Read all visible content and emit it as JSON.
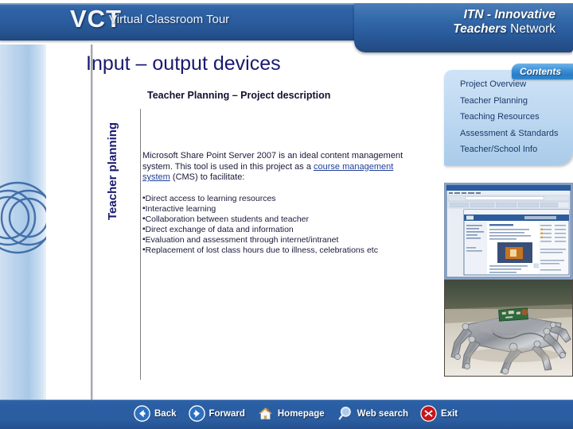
{
  "header": {
    "logo_abbr": "VCT",
    "logo_full": "Virtual Classroom Tour",
    "network_line1": "ITN - Innovative",
    "network_line2_bold": "Teachers",
    "network_line2_rest": " Network"
  },
  "slide": {
    "title": "Input – output devices",
    "subtitle": "Teacher Planning – Project description",
    "side_label": "Teacher planning",
    "paragraph": {
      "part1": "Microsoft Share Point Server 2007 is an ideal content management system. This tool is used in this project as a ",
      "link": "course management system",
      "part2": " (CMS) to facilitate:"
    },
    "bullets": [
      "Direct access to learning resources",
      "Interactive learning",
      "Collaboration between students and teacher",
      "Direct exchange of data and information",
      "Evaluation and assessment through internet/intranet",
      "Replacement of  lost class hours due to illness, celebrations etc"
    ],
    "bullet_marker": "▪"
  },
  "contents": {
    "tab_label": "Contents",
    "items": [
      "Project Overview",
      "Teacher Planning",
      "Teaching  Resources",
      "Assessment & Standards",
      "Teacher/School Info"
    ]
  },
  "media": {
    "screenshot_caption": "sharepoint-site-screenshot",
    "photo_caption": "metal-robot-photo"
  },
  "nav": [
    {
      "label": "Back",
      "icon": "back-arrow-icon"
    },
    {
      "label": "Forward",
      "icon": "forward-arrow-icon"
    },
    {
      "label": "Homepage",
      "icon": "home-icon"
    },
    {
      "label": "Web search",
      "icon": "magnifier-icon"
    },
    {
      "label": "Exit",
      "icon": "exit-x-icon"
    }
  ],
  "colors": {
    "header_blue": "#2a5c9e",
    "title_navy": "#191970",
    "panel_blue": "#bdd8f1",
    "tab_blue": "#3f92d8",
    "exit_red": "#c4161c"
  }
}
